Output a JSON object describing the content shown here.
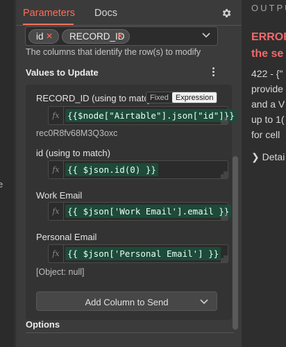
{
  "left": {
    "fragment": "e"
  },
  "tabs": [
    {
      "label": "Parameters",
      "active": true
    },
    {
      "label": "Docs",
      "active": false
    }
  ],
  "settings_icon": "gear-icon",
  "matching_columns": {
    "tags": [
      {
        "label": "id",
        "remove_icon": "close-icon"
      },
      {
        "label": "RECORD_ID",
        "remove_icon": "close-icon"
      }
    ],
    "dropdown_icon": "chevron-down-icon",
    "hint": "The columns that identify the row(s) to modify"
  },
  "values_section": {
    "title": "Values to Update",
    "menu_icon": "kebab-menu-icon"
  },
  "fields": [
    {
      "label": "RECORD_ID (using to match)",
      "mode_toggle": {
        "fixed": "Fixed",
        "expression": "Expression",
        "selected": "Expression"
      },
      "fx": "fx",
      "expression": "{{$node[\"Airtable\"].json[\"id\"]}}",
      "result": "rec0R8fv68M3Q3oxc"
    },
    {
      "label": "id (using to match)",
      "fx": "fx",
      "expression": "{{ $json.id(0) }}",
      "result": ""
    },
    {
      "label": "Work Email",
      "fx": "fx",
      "expression": "{{ $json['Work Email'].email }}",
      "result": ""
    },
    {
      "label": "Personal Email",
      "fx": "fx",
      "expression": "{{ $json['Personal Email'] }}",
      "result": "[Object: null]"
    }
  ],
  "add_column_button": "Add Column to Send",
  "options_title": "Options",
  "output_panel": {
    "title": "OUTPUT",
    "error_lines": [
      "ERROR",
      "the se"
    ],
    "body_lines": [
      "422 - {\"",
      "provide",
      "and a V",
      "up to 1(",
      "for cell"
    ],
    "details": "Detai"
  },
  "colors": {
    "accent": "#ff6d5a",
    "error": "#f46969",
    "expression_bg": "#1d4a3a"
  }
}
